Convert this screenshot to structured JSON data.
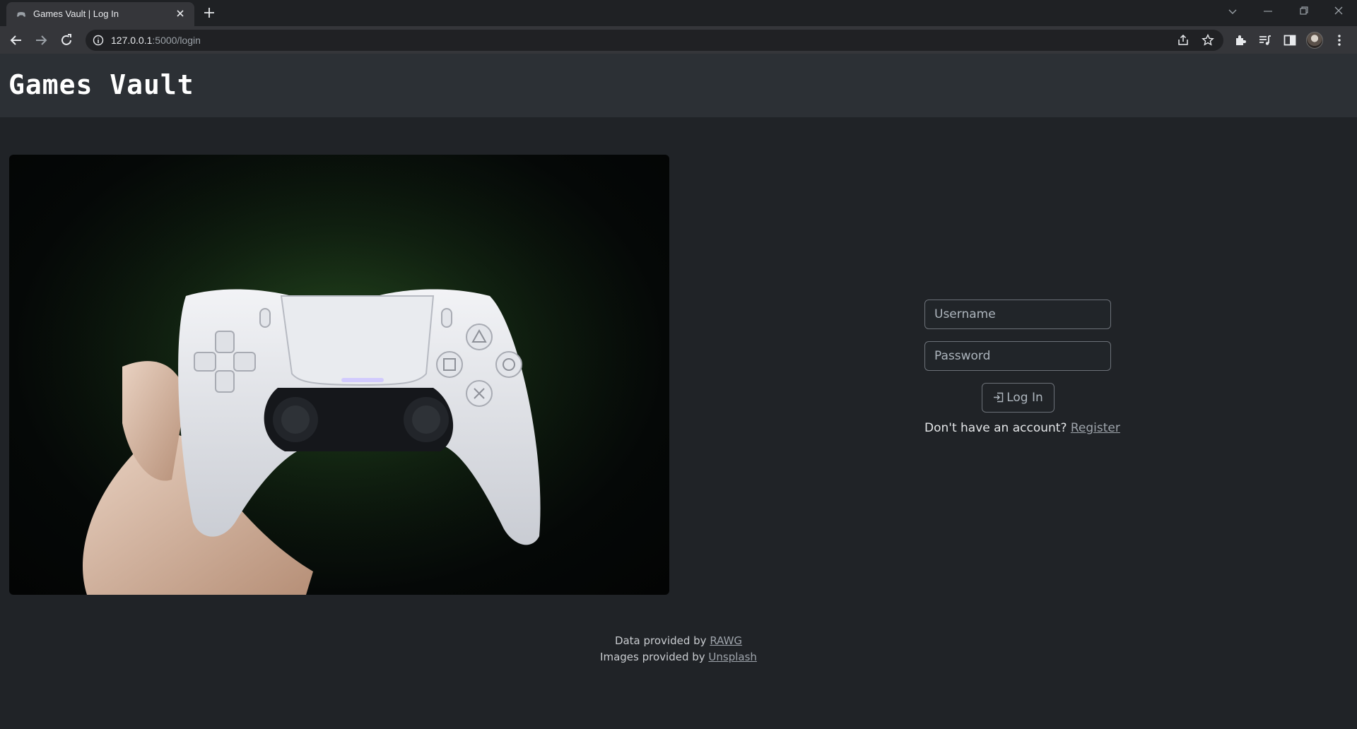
{
  "browser": {
    "tab_title": "Games Vault | Log In",
    "url_host": "127.0.0.1",
    "url_path": ":5000/login"
  },
  "header": {
    "title": "Games Vault"
  },
  "login": {
    "username_placeholder": "Username",
    "password_placeholder": "Password",
    "button_label": "Log In",
    "register_prompt": "Don't have an account?",
    "register_link": "Register"
  },
  "footer": {
    "data_prefix": "Data provided by",
    "data_link": "RAWG",
    "images_prefix": "Images provided by",
    "images_link": "Unsplash"
  },
  "colors": {
    "page_bg": "#202327",
    "header_bg": "#2c3035",
    "link": "#9ea4ab"
  }
}
